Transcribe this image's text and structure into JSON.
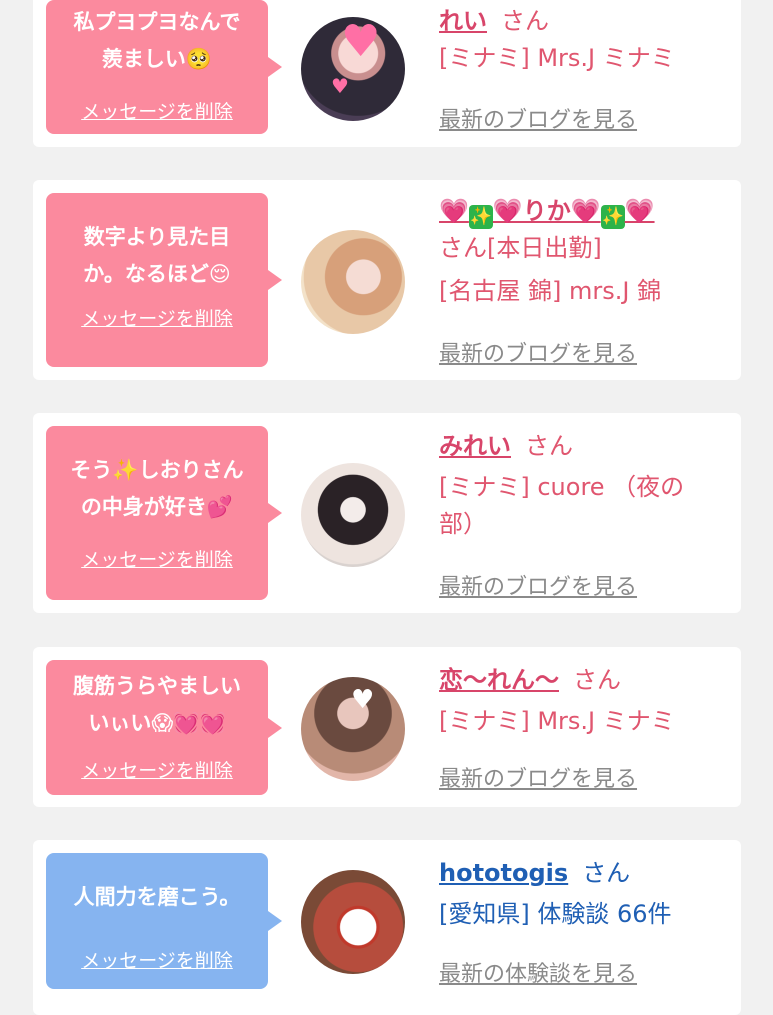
{
  "items": [
    {
      "message_lines": [
        "私プヨプヨなんで",
        "羨ましい🥺"
      ],
      "delete_label": "メッセージを削除",
      "name": "れい",
      "name_suffix": "さん",
      "shop_lines": [
        "[ミナミ] Mrs.J ミナミ"
      ],
      "blog_label": "最新のブログを見る",
      "bubble_color": "#fb8a9e"
    },
    {
      "message_lines": [
        "数字より見た目",
        "か。なるほど😌"
      ],
      "delete_label": "メッセージを削除",
      "name_parts": [
        "💗",
        "✨",
        "💗りか💗",
        "✨",
        "💗"
      ],
      "name_suffix_line": "さん[本日出勤]",
      "shop_lines": [
        "[名古屋 錦] mrs.J 錦"
      ],
      "blog_label": "最新のブログを見る",
      "bubble_color": "#fb8a9e"
    },
    {
      "message_lines": [
        "そう✨しおりさん",
        "の中身が好き💕"
      ],
      "delete_label": "メッセージを削除",
      "name": "みれい",
      "name_suffix": "さん",
      "shop_lines": [
        "[ミナミ] cuore （夜の",
        "部）"
      ],
      "blog_label": "最新のブログを見る",
      "bubble_color": "#fb8a9e"
    },
    {
      "message_lines": [
        "腹筋うらやましい",
        "いぃい😱💓💓"
      ],
      "delete_label": "メッセージを削除",
      "name": "恋〜れん〜",
      "name_suffix": "さん",
      "shop_lines": [
        "[ミナミ] Mrs.J ミナミ"
      ],
      "blog_label": "最新のブログを見る",
      "bubble_color": "#fb8a9e"
    },
    {
      "message_lines": [
        "人間力を磨こう。"
      ],
      "delete_label": "メッセージを削除",
      "name": "hototogis",
      "name_suffix": "さん",
      "shop_lines": [
        "[愛知県] 体験談 66件"
      ],
      "blog_label": "最新の体験談を見る",
      "bubble_color": "#86b4f0"
    }
  ]
}
